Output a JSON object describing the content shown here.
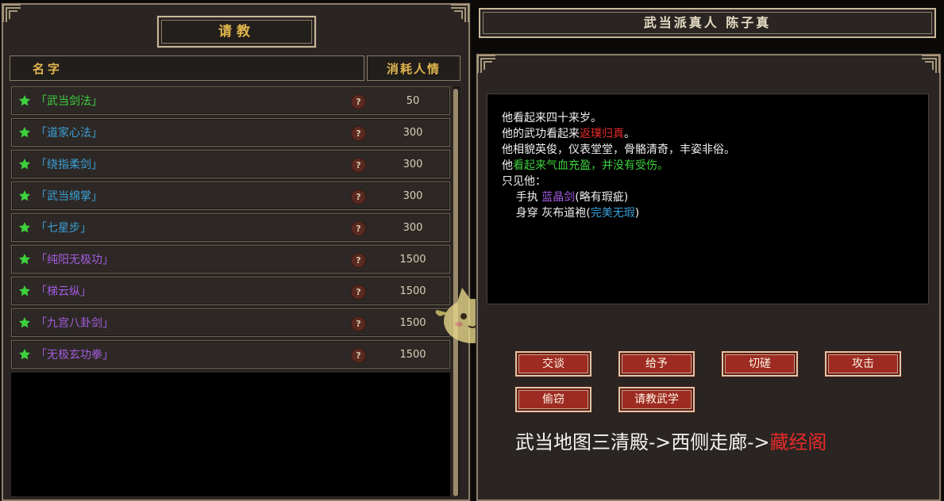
{
  "left_panel": {
    "title": "请教",
    "columns": {
      "name": "名字",
      "cost": "消耗人情"
    },
    "skills": [
      {
        "name": "「武当剑法」",
        "cost": "50",
        "color": "#3ed13e"
      },
      {
        "name": "「道家心法」",
        "cost": "300",
        "color": "#3aa0d8"
      },
      {
        "name": "「绕指柔剑」",
        "cost": "300",
        "color": "#3aa0d8"
      },
      {
        "name": "「武当绵掌」",
        "cost": "300",
        "color": "#3aa0d8"
      },
      {
        "name": "「七星步」",
        "cost": "300",
        "color": "#3aa0d8"
      },
      {
        "name": "「纯阳无极功」",
        "cost": "1500",
        "color": "#a45be0"
      },
      {
        "name": "「梯云纵」",
        "cost": "1500",
        "color": "#a45be0"
      },
      {
        "name": "「九宫八卦剑」",
        "cost": "1500",
        "color": "#a45be0"
      },
      {
        "name": "「无极玄功拳」",
        "cost": "1500",
        "color": "#a45be0"
      }
    ],
    "help_icon_glyph": "?"
  },
  "npc": {
    "title": "武当派真人 陈子真",
    "description": {
      "line1": "他看起来四十来岁。",
      "line2_prefix": "他的武功看起来",
      "line2_highlight": "返璞归真",
      "line2_suffix": "。",
      "line3": "他相貌英俊，仪表堂堂，骨骼清奇，丰姿非俗。",
      "line4_prefix": "他",
      "line4_highlight": "看起来气血充盈，并没有受伤。",
      "line5": "只见他：",
      "line6_prefix": "    手执 ",
      "line6_item": "蓝晶剑",
      "line6_suffix": "(略有瑕疵)",
      "line7_prefix": "    身穿 灰布道袍(",
      "line7_quality": "完美无瑕",
      "line7_suffix": ")"
    },
    "colors": {
      "skill_level": "#e82a2a",
      "health": "#3ed13e",
      "weapon": "#a45be0",
      "quality": "#3aa0d8"
    }
  },
  "actions": {
    "talk": "交谈",
    "give": "给予",
    "spar": "切磋",
    "attack": "攻击",
    "steal": "偷窃",
    "ask_skill": "请教武学"
  },
  "route": {
    "prefix": "武当地图三清殿->西侧走廊->",
    "destination": "藏经阁",
    "destination_color": "#e82a2a"
  }
}
